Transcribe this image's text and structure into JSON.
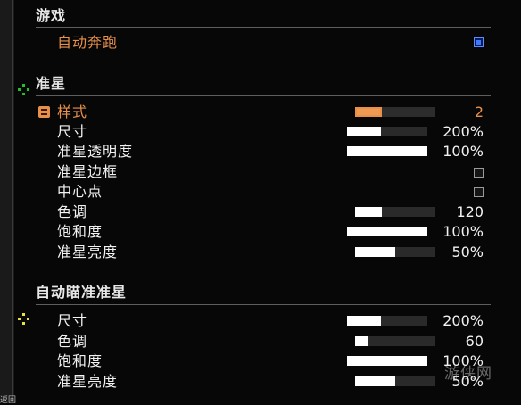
{
  "sections": {
    "game": {
      "title": "游戏"
    },
    "crosshair": {
      "title": "准星"
    },
    "aim_assist": {
      "title": "自动瞄准准星"
    }
  },
  "game": {
    "auto_run": {
      "label": "自动奔跑",
      "checked": true
    }
  },
  "crosshair": {
    "style": {
      "label": "样式",
      "value": "2",
      "level": 0.3
    },
    "size": {
      "label": "尺寸",
      "value": "200%",
      "level": 0.38
    },
    "opacity": {
      "label": "准星透明度",
      "value": "100%",
      "level": 1.0
    },
    "border": {
      "label": "准星边框",
      "checked": false
    },
    "center_dot": {
      "label": "中心点",
      "checked": false
    },
    "hue": {
      "label": "色调",
      "value": "120",
      "level": 0.33
    },
    "saturation": {
      "label": "饱和度",
      "value": "100%",
      "level": 1.0
    },
    "brightness": {
      "label": "准星亮度",
      "value": "50%",
      "level": 0.5
    }
  },
  "aim_assist": {
    "size": {
      "label": "尺寸",
      "value": "200%",
      "level": 0.38
    },
    "hue": {
      "label": "色调",
      "value": "60",
      "level": 0.16
    },
    "saturation": {
      "label": "饱和度",
      "value": "100%",
      "level": 1.0
    },
    "brightness": {
      "label": "准星亮度",
      "value": "50%",
      "level": 0.5
    }
  },
  "watermark": "游侠网",
  "corner_text": "返回",
  "colors": {
    "accent": "#e8904a",
    "checkbox_on": "#3a7cff",
    "marker_green": "#22c02a",
    "marker_yellow": "#e8e23a"
  },
  "icons": {
    "crosshair_marker": "green-dots-icon",
    "aim_marker": "yellow-dots-icon",
    "selected_row": "orange-row-icon"
  }
}
